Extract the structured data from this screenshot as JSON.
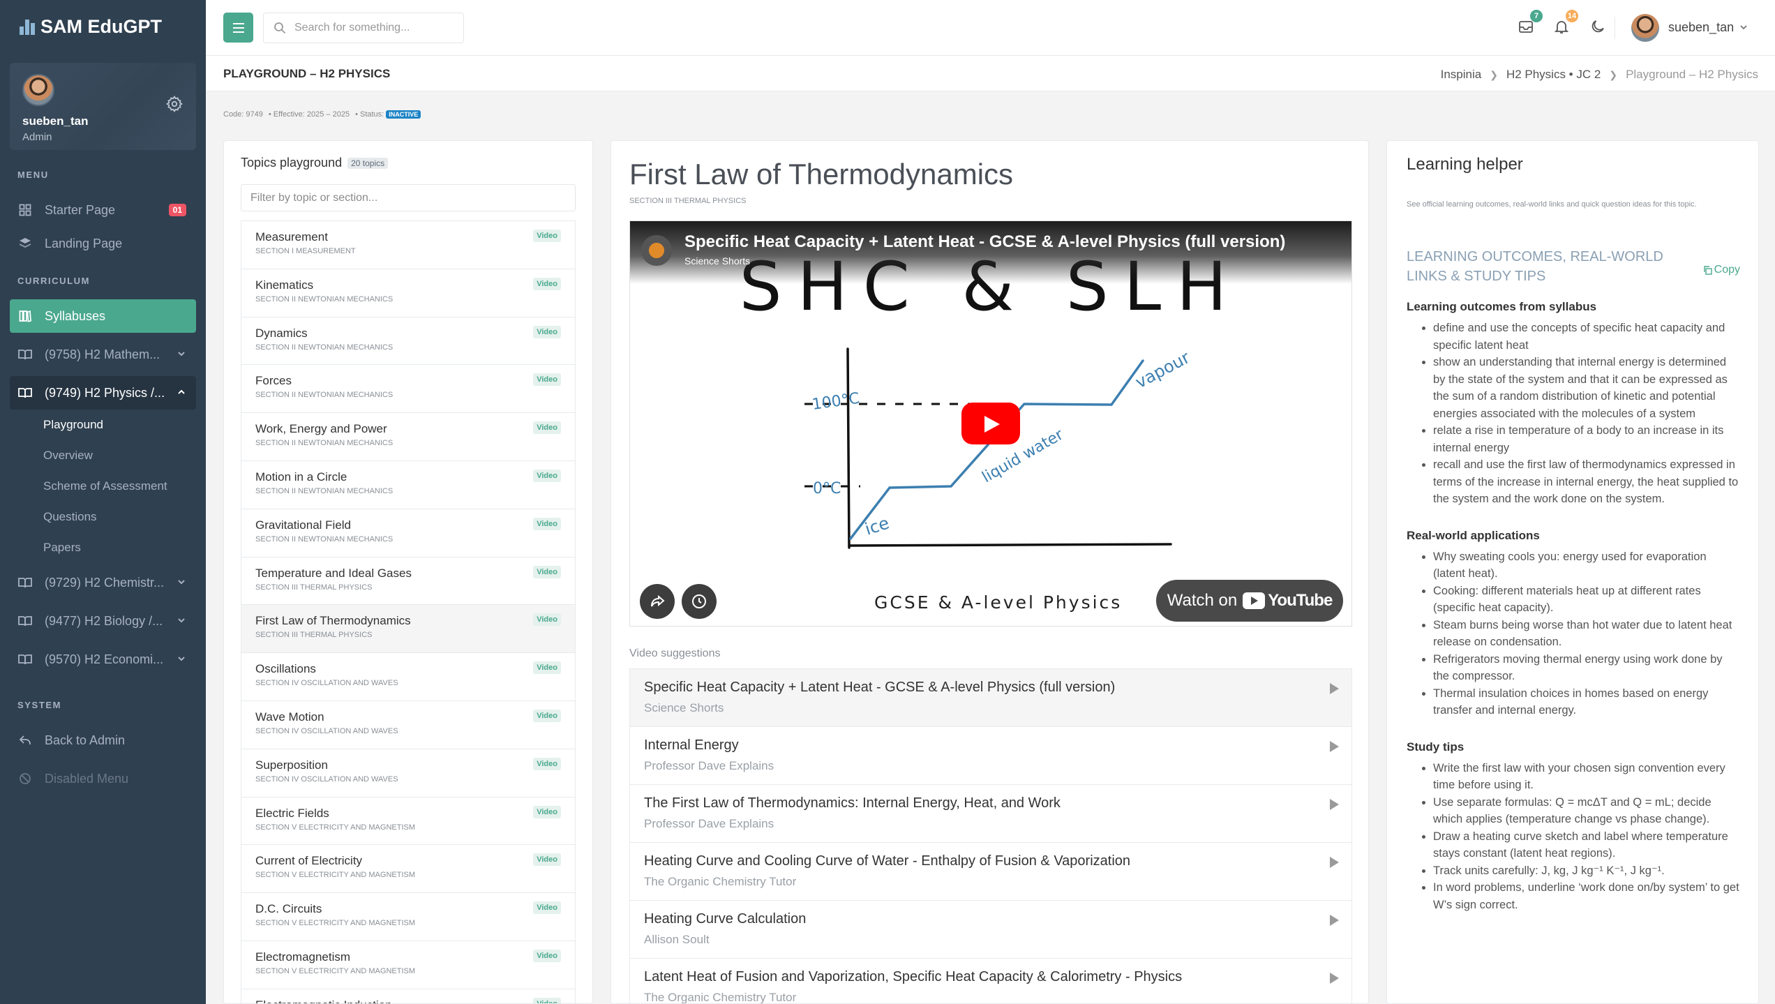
{
  "app": {
    "brand": "SAM EduGPT"
  },
  "profile": {
    "username": "sueben_tan",
    "role": "Admin"
  },
  "sidebar": {
    "menu_heading": "MENU",
    "menu": [
      {
        "label": "Starter Page",
        "badge": "01"
      },
      {
        "label": "Landing Page"
      }
    ],
    "curriculum_heading": "CURRICULUM",
    "curriculum": [
      {
        "label": "Syllabuses"
      },
      {
        "label": "(9758) H2 Mathem..."
      },
      {
        "label": "(9749) H2 Physics /..."
      },
      {
        "label": "(9729) H2 Chemistr..."
      },
      {
        "label": "(9477) H2 Biology /..."
      },
      {
        "label": "(9570) H2 Economi..."
      }
    ],
    "physics_sub": [
      {
        "label": "Playground"
      },
      {
        "label": "Overview"
      },
      {
        "label": "Scheme of Assessment"
      },
      {
        "label": "Questions"
      },
      {
        "label": "Papers"
      }
    ],
    "system_heading": "SYSTEM",
    "system": [
      {
        "label": "Back to Admin"
      },
      {
        "label": "Disabled Menu"
      }
    ]
  },
  "topbar": {
    "search_placeholder": "Search for something...",
    "mail_count": "7",
    "notif_count": "14",
    "username": "sueben_tan",
    "colors": {
      "mail_badge": "#4aa88e",
      "notif_badge": "#f8ac59"
    }
  },
  "page": {
    "title": "PLAYGROUND – H2 PHYSICS",
    "breadcrumb": [
      "Inspinia",
      "H2 Physics • JC 2",
      "Playground – H2 Physics"
    ],
    "meta": {
      "code": "Code: 9749",
      "effective": "• Effective: 2025 – 2025",
      "status_label": "• Status:",
      "status": "INACTIVE"
    }
  },
  "topics_panel": {
    "title": "Topics playground",
    "count": "20 topics",
    "filter_placeholder": "Filter by topic or section...",
    "video_badge": "Video",
    "topics": [
      {
        "name": "Measurement",
        "section": "SECTION I MEASUREMENT"
      },
      {
        "name": "Kinematics",
        "section": "SECTION II NEWTONIAN MECHANICS"
      },
      {
        "name": "Dynamics",
        "section": "SECTION II NEWTONIAN MECHANICS"
      },
      {
        "name": "Forces",
        "section": "SECTION II NEWTONIAN MECHANICS"
      },
      {
        "name": "Work, Energy and Power",
        "section": "SECTION II NEWTONIAN MECHANICS"
      },
      {
        "name": "Motion in a Circle",
        "section": "SECTION II NEWTONIAN MECHANICS"
      },
      {
        "name": "Gravitational Field",
        "section": "SECTION II NEWTONIAN MECHANICS"
      },
      {
        "name": "Temperature and Ideal Gases",
        "section": "SECTION III THERMAL PHYSICS"
      },
      {
        "name": "First Law of Thermodynamics",
        "section": "SECTION III THERMAL PHYSICS"
      },
      {
        "name": "Oscillations",
        "section": "SECTION IV OSCILLATION AND WAVES"
      },
      {
        "name": "Wave Motion",
        "section": "SECTION IV OSCILLATION AND WAVES"
      },
      {
        "name": "Superposition",
        "section": "SECTION IV OSCILLATION AND WAVES"
      },
      {
        "name": "Electric Fields",
        "section": "SECTION V ELECTRICITY AND MAGNETISM"
      },
      {
        "name": "Current of Electricity",
        "section": "SECTION V ELECTRICITY AND MAGNETISM"
      },
      {
        "name": "D.C. Circuits",
        "section": "SECTION V ELECTRICITY AND MAGNETISM"
      },
      {
        "name": "Electromagnetism",
        "section": "SECTION V ELECTRICITY AND MAGNETISM"
      },
      {
        "name": "Electromagnetic Induction",
        "section": ""
      }
    ]
  },
  "main": {
    "title": "First Law of Thermodynamics",
    "section": "SECTION III THERMAL PHYSICS",
    "video": {
      "title": "Specific Heat Capacity + Latent Heat - GCSE & A-level Physics (full version)",
      "channel": "Science Shorts",
      "overlay_text": "SHC & SLH",
      "footer_text": "GCSE & A-level Physics",
      "watch_label": "Watch on",
      "yt_label": "YouTube",
      "graph_labels": {
        "y100": "100°C",
        "y0": "0°C",
        "ice": "ice",
        "water": "liquid water",
        "vapour": "vapour"
      }
    },
    "suggestions_label": "Video suggestions",
    "suggestions": [
      {
        "title": "Specific Heat Capacity + Latent Heat - GCSE & A-level Physics (full version)",
        "channel": "Science Shorts"
      },
      {
        "title": "Internal Energy",
        "channel": "Professor Dave Explains"
      },
      {
        "title": "The First Law of Thermodynamics: Internal Energy, Heat, and Work",
        "channel": "Professor Dave Explains"
      },
      {
        "title": "Heating Curve and Cooling Curve of Water - Enthalpy of Fusion & Vaporization",
        "channel": "The Organic Chemistry Tutor"
      },
      {
        "title": "Heating Curve Calculation",
        "channel": "Allison Soult"
      },
      {
        "title": "Latent Heat of Fusion and Vaporization, Specific Heat Capacity & Calorimetry - Physics",
        "channel": "The Organic Chemistry Tutor"
      }
    ]
  },
  "helper": {
    "title": "Learning helper",
    "desc": "See official learning outcomes, real-world links and quick question ideas for this topic.",
    "section_title": "LEARNING OUTCOMES, REAL-WORLD LINKS & STUDY TIPS",
    "copy_label": "Copy",
    "outcomes_heading": "Learning outcomes from syllabus",
    "outcomes": [
      "define and use the concepts of specific heat capacity and specific latent heat",
      "show an understanding that internal energy is determined by the state of the system and that it can be expressed as the sum of a random distribution of kinetic and potential energies associated with the molecules of a system",
      "relate a rise in temperature of a body to an increase in its internal energy",
      "recall and use the first law of thermodynamics expressed in terms of the increase in internal energy, the heat supplied to the system and the work done on the system."
    ],
    "applications_heading": "Real-world applications",
    "applications": [
      "Why sweating cools you: energy used for evaporation (latent heat).",
      "Cooking: different materials heat up at different rates (specific heat capacity).",
      "Steam burns being worse than hot water due to latent heat release on condensation.",
      "Refrigerators moving thermal energy using work done by the compressor.",
      "Thermal insulation choices in homes based on energy transfer and internal energy."
    ],
    "tips_heading": "Study tips",
    "tips": [
      "Write the first law with your chosen sign convention every time before using it.",
      "Use separate formulas: Q = mcΔT and Q = mL; decide which applies (temperature change vs phase change).",
      "Draw a heating curve sketch and label where temperature stays constant (latent heat regions).",
      "Track units carefully: J, kg, J kg⁻¹ K⁻¹, J kg⁻¹.",
      "In word problems, underline ‘work done on/by system’ to get W’s sign correct."
    ]
  }
}
